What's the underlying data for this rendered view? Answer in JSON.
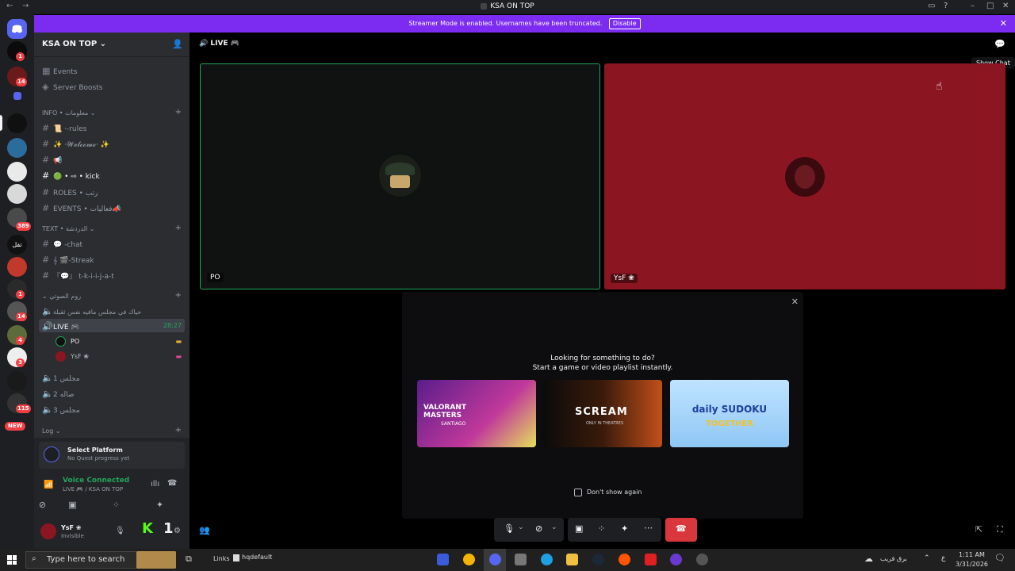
{
  "window": {
    "title": "KSA ON TOP"
  },
  "banner": {
    "text": "Streamer Mode is enabled. Usernames have been truncated.",
    "button": "Disable"
  },
  "server_badges": [
    "1",
    "14",
    "389",
    "1",
    "14",
    "4",
    "3",
    "115"
  ],
  "server_rail": {
    "new_label": "NEW",
    "text_server": "تفل"
  },
  "guild": {
    "name": "KSA ON TOP"
  },
  "top_items": [
    "Events",
    "Server Boosts"
  ],
  "categories": {
    "info": "INFO • معلومات",
    "text": "TEXT • الدردشة",
    "voice": "روم الصوتي",
    "log": "Log"
  },
  "info_channels": [
    "📜 ·-rules",
    "✨ ·𝓦𝓮𝓵𝓬𝓸𝓶𝓮· ✨",
    "📢",
    "🟢 • ⇨ • kick",
    "ROLES • رتب",
    "EVENTS • فعاليات📣"
  ],
  "text_channels": [
    "💬 -chat",
    "𝄞 🎬-Streak",
    "『💬』 t-k-i-i-j-a-t"
  ],
  "voice_channels": {
    "first": "حياك في مجلس مافيه نفس ثقيلة",
    "live": "LIVE 🎮",
    "live_time": "28:27",
    "members": [
      "PO",
      "YsF ❀"
    ],
    "others": [
      "مجلس 1",
      "صاله 2",
      "مجلس 3"
    ]
  },
  "quest": {
    "title": "Select Platform",
    "subtitle": "No Quest progress yet"
  },
  "voice_status": {
    "title": "Voice Connected",
    "channel": "LIVE 🎮 / KSA ON TOP"
  },
  "user": {
    "name": "YsF ❀",
    "status": "Invisible"
  },
  "call": {
    "header": "LIVE 🎮",
    "tiles": [
      {
        "name": "PO",
        "color": "#0f1210"
      },
      {
        "name": "YsF ❀",
        "color": "#8b1622"
      }
    ],
    "show_chat_tooltip": "Show Chat"
  },
  "activity": {
    "line1": "Looking for something to do?",
    "line2": "Start a game or video playlist instantly.",
    "cards": [
      {
        "label": "VALORANT MASTERS",
        "sublabel": "SANTIAGO"
      },
      {
        "label": "SCREAM",
        "sublabel": "ONLY IN THEATRES"
      },
      {
        "label": "daily SUDOKU",
        "sublabel": "TOGETHER"
      }
    ],
    "dont_show": "Don't show again"
  },
  "taskbar": {
    "search_placeholder": "Type here to search",
    "links": "Links",
    "hqdefault": "hqdefault",
    "weather": "برق قريب",
    "time": "1:11 AM",
    "date": "3/31/2026",
    "lang": "ع"
  },
  "colors": {
    "accent": "#7b2cf0",
    "green": "#23a55a",
    "red": "#da373c",
    "tile_red": "#8b1622"
  }
}
